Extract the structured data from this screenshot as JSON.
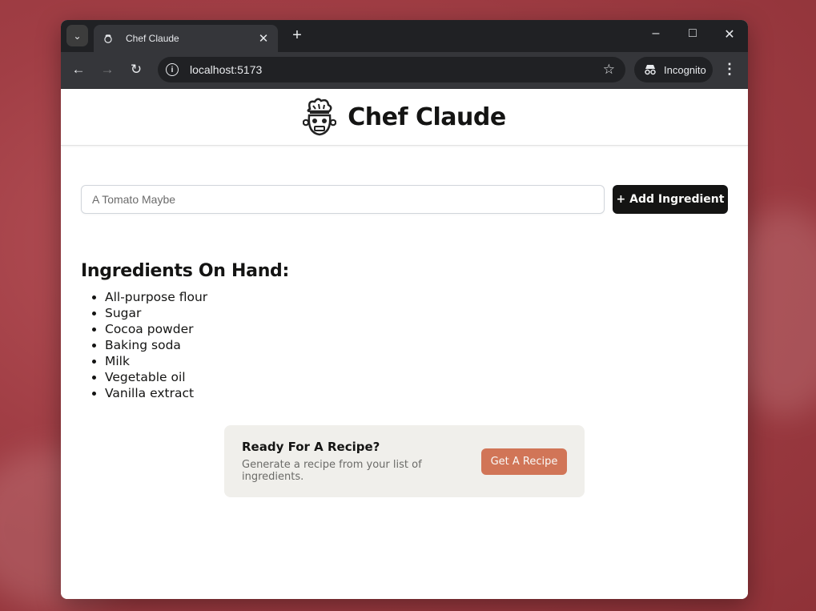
{
  "browser": {
    "tab_title": "Chef Claude",
    "new_tab_symbol": "+",
    "url": "localhost:5173",
    "incognito_label": "Incognito"
  },
  "header": {
    "title": "Chef Claude"
  },
  "form": {
    "placeholder": "A Tomato Maybe",
    "add_button_label": "+ Add Ingredient"
  },
  "ingredients": {
    "heading": "Ingredients On Hand:",
    "items": [
      "All-purpose flour",
      "Sugar",
      "Cocoa powder",
      "Baking soda",
      "Milk",
      "Vegetable oil",
      "Vanilla extract"
    ]
  },
  "recipe_card": {
    "title": "Ready For A Recipe?",
    "subtitle": "Generate a recipe from your list of ingredients.",
    "button_label": "Get A Recipe"
  },
  "colors": {
    "accent_button": "#d17557",
    "dark_button": "#141413",
    "card_bg": "#f0efeb"
  },
  "icons": [
    "chef-hat-icon",
    "close-icon",
    "back-icon",
    "forward-icon",
    "reload-icon",
    "site-info-icon",
    "star-icon",
    "incognito-icon",
    "menu-icon"
  ]
}
